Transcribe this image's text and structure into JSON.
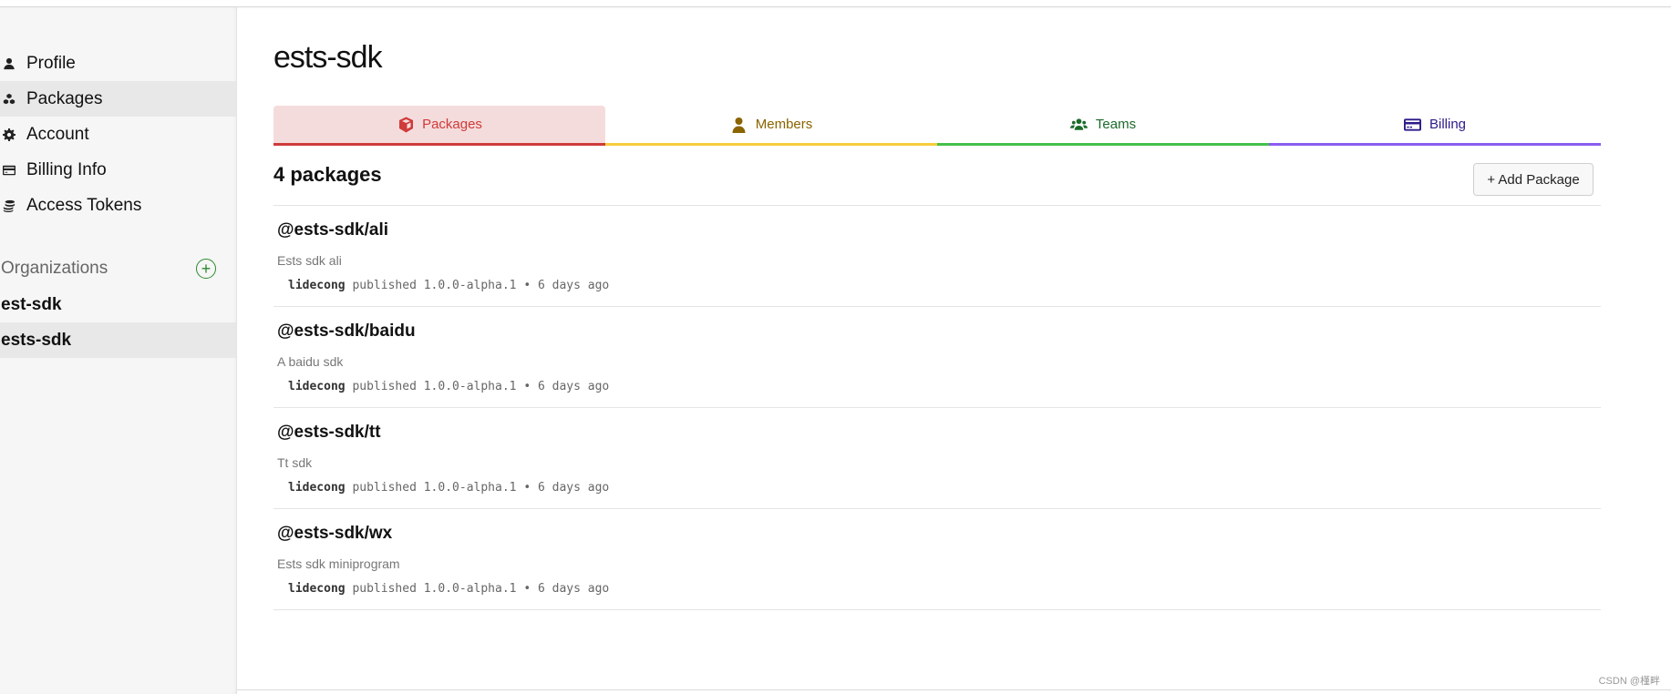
{
  "sidebar": {
    "items": [
      {
        "label": "Profile",
        "icon": "user-icon",
        "active": false
      },
      {
        "label": "Packages",
        "icon": "cubes-icon",
        "active": true
      },
      {
        "label": "Account",
        "icon": "gear-icon",
        "active": false
      },
      {
        "label": "Billing Info",
        "icon": "credit-card-icon",
        "active": false
      },
      {
        "label": "Access Tokens",
        "icon": "coins-icon",
        "active": false
      }
    ],
    "organizations": {
      "label": "Organizations",
      "add_icon": "plus-circle-icon",
      "items": [
        {
          "label": "est-sdk",
          "active": false
        },
        {
          "label": "ests-sdk",
          "active": true
        }
      ]
    }
  },
  "main": {
    "title": "ests-sdk",
    "tabs": [
      {
        "label": "Packages",
        "icon": "cube-icon",
        "color": "#cf3a3a",
        "active": true
      },
      {
        "label": "Members",
        "icon": "user-icon",
        "color": "#8a6400",
        "active": false
      },
      {
        "label": "Teams",
        "icon": "users-icon",
        "color": "#1c6b2a",
        "active": false
      },
      {
        "label": "Billing",
        "icon": "credit-card-icon",
        "color": "#2c1b8a",
        "active": false
      }
    ],
    "count_label": "4 packages",
    "add_button": "+ Add Package",
    "packages": [
      {
        "name": "@ests-sdk/ali",
        "description": "Ests sdk ali",
        "author": "lidecong",
        "action": "published",
        "version": "1.0.0-alpha.1",
        "separator": "•",
        "time": "6 days ago"
      },
      {
        "name": "@ests-sdk/baidu",
        "description": "A baidu sdk",
        "author": "lidecong",
        "action": "published",
        "version": "1.0.0-alpha.1",
        "separator": "•",
        "time": "6 days ago"
      },
      {
        "name": "@ests-sdk/tt",
        "description": "Tt sdk",
        "author": "lidecong",
        "action": "published",
        "version": "1.0.0-alpha.1",
        "separator": "•",
        "time": "6 days ago"
      },
      {
        "name": "@ests-sdk/wx",
        "description": "Ests sdk miniprogram",
        "author": "lidecong",
        "action": "published",
        "version": "1.0.0-alpha.1",
        "separator": "•",
        "time": "6 days ago"
      }
    ]
  },
  "watermark": "CSDN @槿畔"
}
